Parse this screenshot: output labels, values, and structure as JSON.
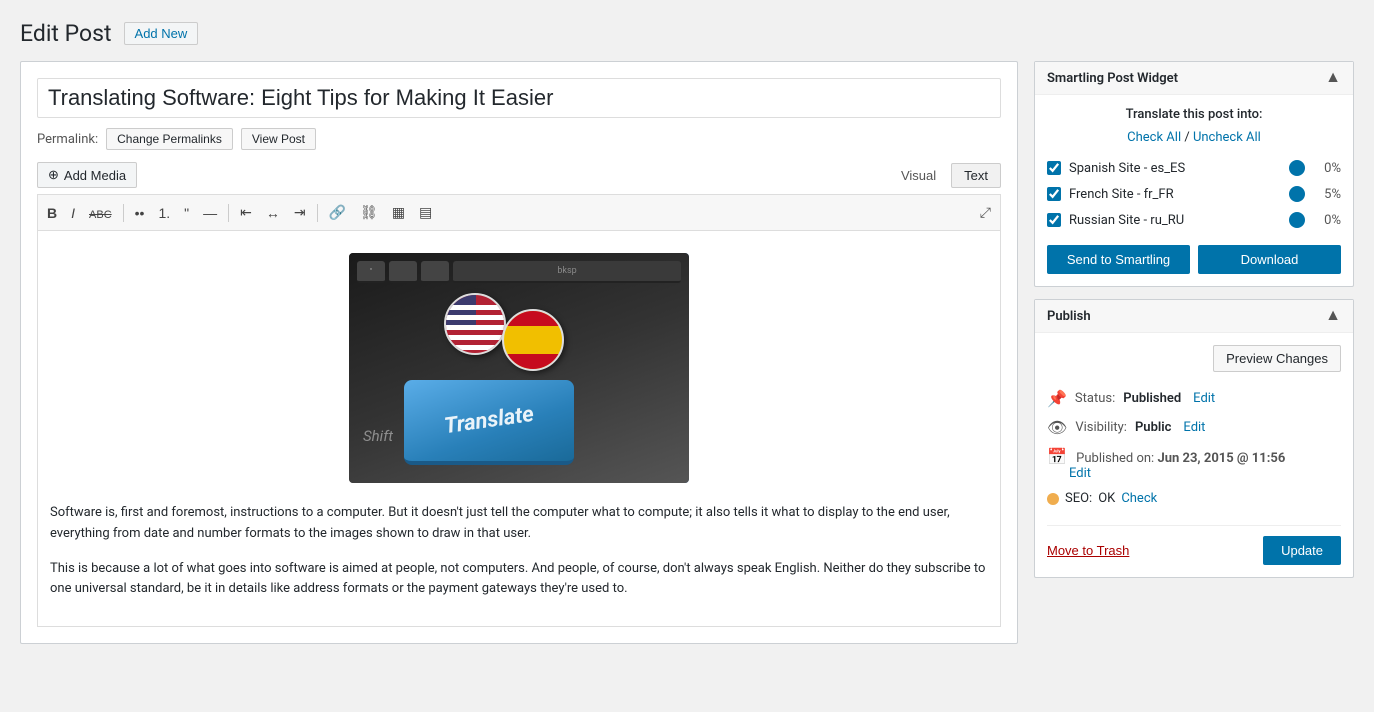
{
  "page": {
    "title": "Edit Post",
    "add_new_label": "Add New"
  },
  "post": {
    "title": "Translating Software: Eight Tips for Making It Easier",
    "permalink_label": "Permalink:",
    "change_permalinks": "Change Permalinks",
    "view_post": "View Post"
  },
  "toolbar": {
    "add_media": "Add Media",
    "visual_tab": "Visual",
    "text_tab": "Text"
  },
  "content": {
    "paragraph1": "Software is, first and foremost, instructions to a computer. But it doesn't just tell the computer what to compute; it also tells it what to display to the end user, everything from date and number formats to the images shown to draw in that user.",
    "paragraph2": "This is because a lot of what goes into software is aimed at people, not computers. And people, of course, don't always speak English. Neither do they subscribe to one universal standard, be it in details like address formats or the payment gateways they're used to."
  },
  "smartling_widget": {
    "title": "Smartling Post Widget",
    "translate_label": "Translate this post into:",
    "check_all": "Check All",
    "uncheck_all": "Uncheck All",
    "languages": [
      {
        "name": "Spanish Site - es_ES",
        "checked": true,
        "progress": 0,
        "progress_pct": "0%"
      },
      {
        "name": "French Site - fr_FR",
        "checked": true,
        "progress": 5,
        "progress_pct": "5%"
      },
      {
        "name": "Russian Site - ru_RU",
        "checked": true,
        "progress": 0,
        "progress_pct": "0%"
      }
    ],
    "send_btn": "Send to Smartling",
    "download_btn": "Download"
  },
  "publish_widget": {
    "title": "Publish",
    "preview_changes": "Preview Changes",
    "status_label": "Status:",
    "status_value": "Published",
    "status_edit": "Edit",
    "visibility_label": "Visibility:",
    "visibility_value": "Public",
    "visibility_edit": "Edit",
    "published_label": "Published on:",
    "published_value": "Jun 23, 2015 @ 11:56",
    "published_edit": "Edit",
    "seo_label": "SEO:",
    "seo_value": "OK",
    "seo_check": "Check",
    "move_to_trash": "Move to Trash",
    "update_btn": "Update"
  },
  "icons": {
    "bold": "B",
    "italic": "I",
    "strikethrough": "ABC",
    "unordered_list": "≡",
    "ordered_list": "≡",
    "blockquote": "❝",
    "hr": "—",
    "align_left": "≡",
    "align_center": "≡",
    "align_right": "≡",
    "link": "🔗",
    "unlink": "⛓",
    "table": "▦",
    "fullscreen": "⤢",
    "status_pin": "📌",
    "visibility_eye": "👁",
    "calendar": "📅",
    "collapse_arrow": "▲"
  }
}
